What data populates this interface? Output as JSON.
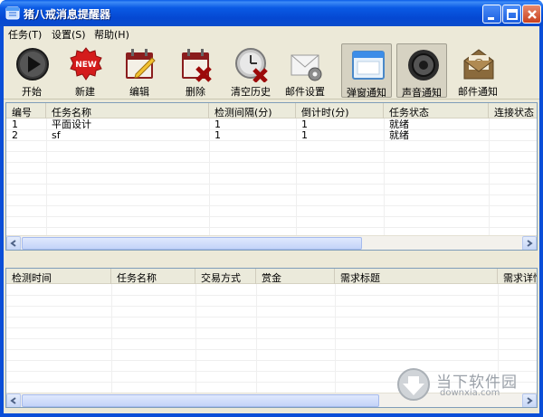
{
  "window": {
    "title": "猪八戒消息提醒器"
  },
  "menu": [
    {
      "label": "任务(T)"
    },
    {
      "label": "设置(S)"
    },
    {
      "label": "帮助(H)"
    }
  ],
  "toolbar": [
    {
      "label": "开始",
      "icon": "play-icon"
    },
    {
      "label": "新建",
      "icon": "new-badge-icon"
    },
    {
      "label": "编辑",
      "icon": "calendar-edit-icon"
    },
    {
      "label": "删除",
      "icon": "calendar-delete-icon"
    },
    {
      "label": "清空历史",
      "icon": "clock-clear-icon"
    },
    {
      "label": "邮件设置",
      "icon": "mail-settings-icon"
    },
    {
      "label": "弹窗通知",
      "icon": "popup-window-icon",
      "active": true
    },
    {
      "label": "声音通知",
      "icon": "speaker-icon",
      "active": true
    },
    {
      "label": "邮件通知",
      "icon": "mail-notify-icon"
    }
  ],
  "tasks_table": {
    "columns": [
      "编号",
      "任务名称",
      "检测间隔(分)",
      "倒计时(分)",
      "任务状态",
      "连接状态"
    ],
    "rows": [
      [
        "1",
        "平面设计",
        "1",
        "1",
        "就绪",
        ""
      ],
      [
        "2",
        "sf",
        "1",
        "1",
        "就绪",
        ""
      ]
    ]
  },
  "messages_table": {
    "columns": [
      "检测时间",
      "任务名称",
      "交易方式",
      "赏金",
      "需求标题",
      "需求详情"
    ],
    "rows": []
  },
  "watermark": {
    "name": "当下软件园",
    "url": "downxia.com"
  },
  "colors": {
    "titlebar": "#0a54e0",
    "client": "#ece9d8",
    "grid_border": "#7f9db9"
  }
}
